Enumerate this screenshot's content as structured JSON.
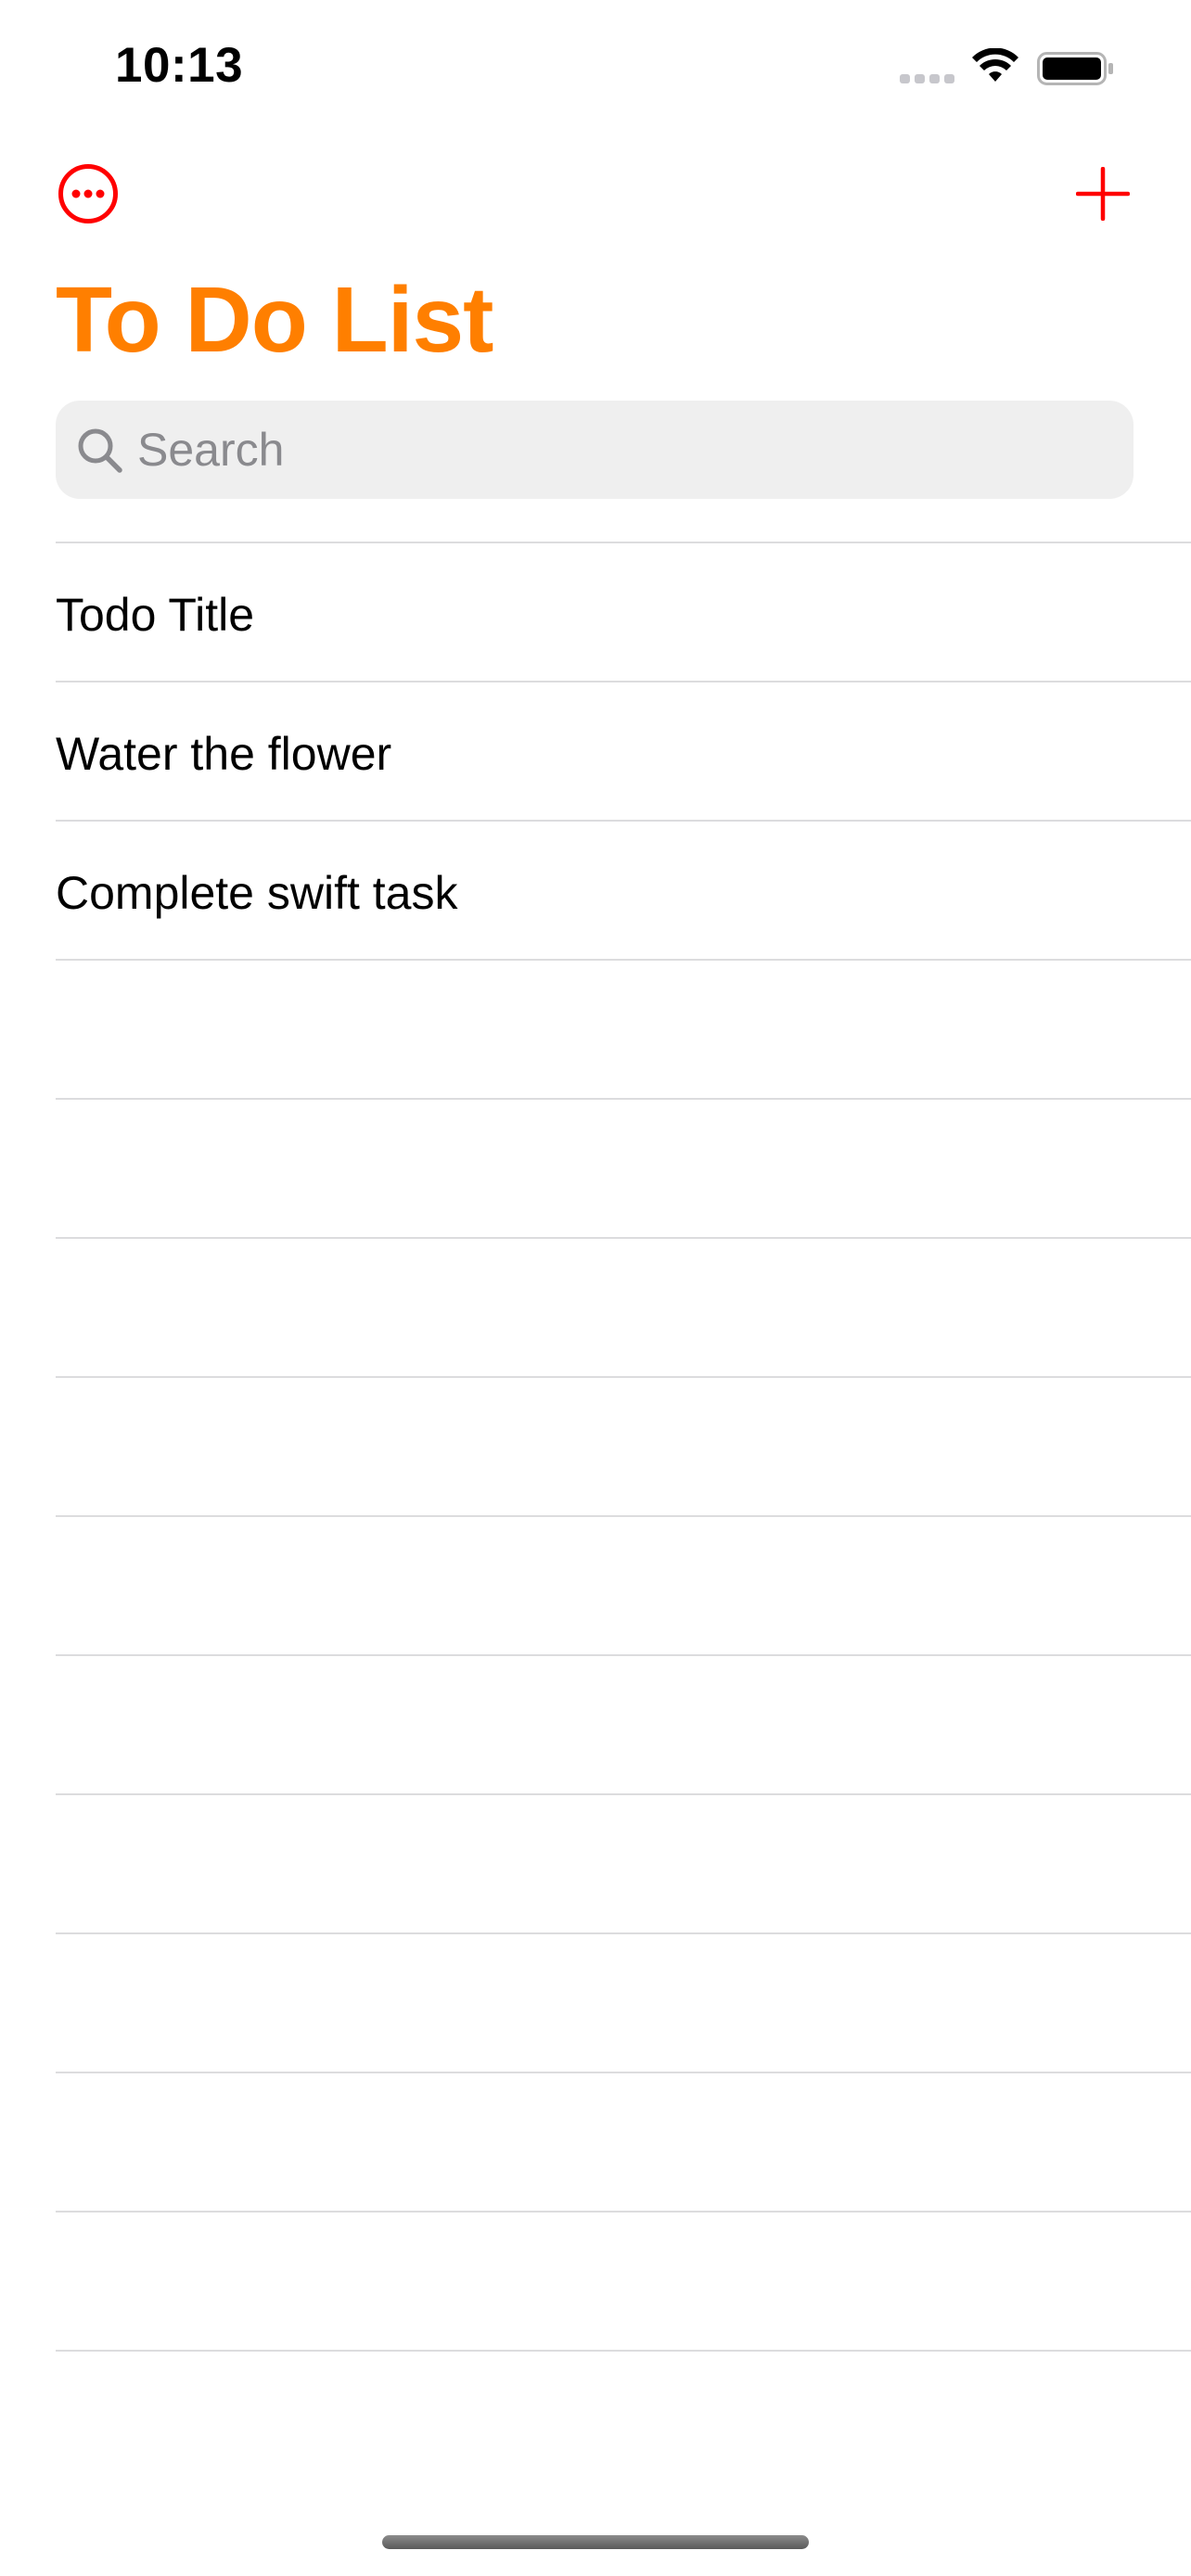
{
  "status_bar": {
    "time": "10:13"
  },
  "nav": {
    "more_icon": "ellipsis-circle-icon",
    "add_icon": "plus-icon",
    "title": "To Do List"
  },
  "search": {
    "placeholder": "Search",
    "value": ""
  },
  "todos": [
    {
      "title": "Todo Title"
    },
    {
      "title": "Water the flower"
    },
    {
      "title": "Complete swift task"
    }
  ],
  "colors": {
    "accent_red": "#ff0000",
    "title_orange": "#ff7f00",
    "search_background": "#efefef",
    "separator": "#dcdcde"
  }
}
